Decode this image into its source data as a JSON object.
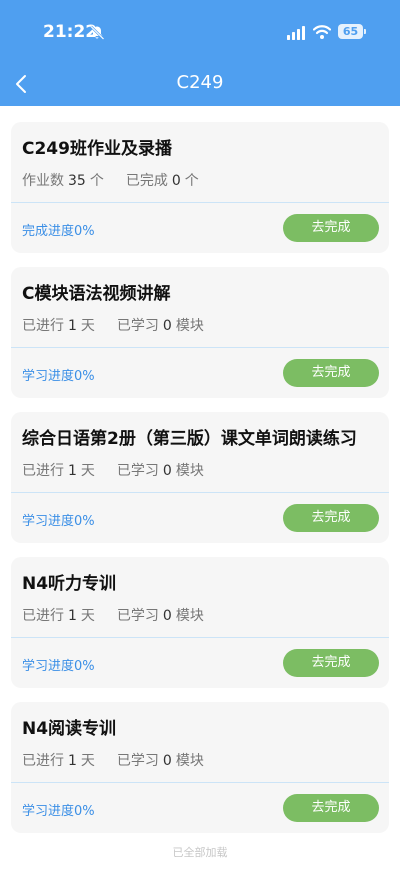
{
  "status_bar": {
    "time": "21:22",
    "battery": "65"
  },
  "header": {
    "title": "C249"
  },
  "cards": [
    {
      "title": "C249班作业及录播",
      "meta1_label": "作业数",
      "meta1_value": "35",
      "meta1_unit": "个",
      "meta2_label": "已完成",
      "meta2_value": "0",
      "meta2_unit": "个",
      "progress": "完成进度0%",
      "button": "去完成"
    },
    {
      "title": "C模块语法视频讲解",
      "meta1_label": "已进行",
      "meta1_value": "1",
      "meta1_unit": "天",
      "meta2_label": "已学习",
      "meta2_value": "0",
      "meta2_unit": "模块",
      "progress": "学习进度0%",
      "button": "去完成"
    },
    {
      "title": "综合日语第2册（第三版）课文单词朗读练习",
      "meta1_label": "已进行",
      "meta1_value": "1",
      "meta1_unit": "天",
      "meta2_label": "已学习",
      "meta2_value": "0",
      "meta2_unit": "模块",
      "progress": "学习进度0%",
      "button": "去完成"
    },
    {
      "title": "N4听力专训",
      "meta1_label": "已进行",
      "meta1_value": "1",
      "meta1_unit": "天",
      "meta2_label": "已学习",
      "meta2_value": "0",
      "meta2_unit": "模块",
      "progress": "学习进度0%",
      "button": "去完成"
    },
    {
      "title": "N4阅读专训",
      "meta1_label": "已进行",
      "meta1_value": "1",
      "meta1_unit": "天",
      "meta2_label": "已学习",
      "meta2_value": "0",
      "meta2_unit": "模块",
      "progress": "学习进度0%",
      "button": "去完成"
    }
  ],
  "footer": {
    "text": "已全部加载"
  },
  "colors": {
    "header_bg": "#4f9ff0",
    "button_bg": "#7cbd63",
    "progress_text": "#3b8fe6"
  }
}
